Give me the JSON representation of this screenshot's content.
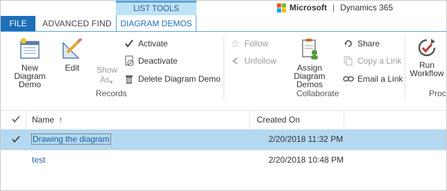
{
  "tabs": {
    "file": "FILE",
    "advanced_find": "ADVANCED FIND",
    "context_group": "LIST TOOLS",
    "context_tab": "DIAGRAM DEMOS"
  },
  "brand": {
    "company": "Microsoft",
    "product": "Dynamics 365",
    "logo_colors": [
      "#f25022",
      "#7fba00",
      "#00a4ef",
      "#ffb900"
    ]
  },
  "ribbon": {
    "new_label": "New Diagram Demo",
    "edit_label": "Edit",
    "show_as_label": "Show As",
    "activate_label": "Activate",
    "deactivate_label": "Deactivate",
    "delete_label": "Delete Diagram Demo",
    "records_group": "Records",
    "follow_label": "Follow",
    "unfollow_label": "Unfollow",
    "assign_label": "Assign Diagram Demos",
    "share_label": "Share",
    "copy_link_label": "Copy a Link",
    "email_link_label": "Email a Link",
    "collaborate_group": "Collaborate",
    "run_workflow_label": "Run Workflow",
    "process_group": "Proc"
  },
  "grid": {
    "col_name": "Name",
    "col_created": "Created On",
    "rows": [
      {
        "name": "Drawing the diagram",
        "created_on": "2/20/2018 11:32 PM",
        "selected": true
      },
      {
        "name": "test",
        "created_on": "2/20/2018 10:48 PM",
        "selected": false
      }
    ]
  },
  "colors": {
    "accent": "#1e6fb8",
    "context_header": "#bfe3f6",
    "selected_row": "#b4d8ef"
  }
}
